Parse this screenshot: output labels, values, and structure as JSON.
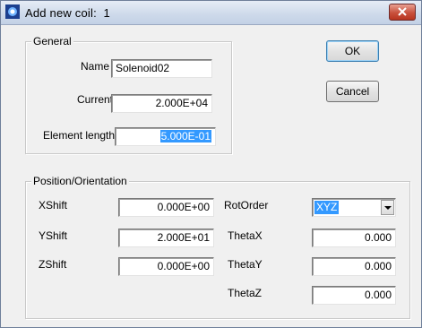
{
  "window": {
    "title": "Add new coil:  1",
    "close_icon": "close-icon",
    "app_icon": "app-icon"
  },
  "general": {
    "group_label": "General",
    "name_label": "Name",
    "name_value": "Solenoid02",
    "current_label": "Current",
    "current_value": "2.000E+04",
    "element_length_label": "Element length",
    "element_length_value": "5.000E-01"
  },
  "buttons": {
    "ok_label": "OK",
    "cancel_label": "Cancel"
  },
  "position": {
    "group_label": "Position/Orientation",
    "xshift_label": "XShift",
    "xshift_value": "0.000E+00",
    "yshift_label": "YShift",
    "yshift_value": "2.000E+01",
    "zshift_label": "ZShift",
    "zshift_value": "0.000E+00",
    "rotorder_label": "RotOrder",
    "rotorder_value": "XYZ",
    "thetax_label": "ThetaX",
    "thetax_value": "0.000",
    "thetay_label": "ThetaY",
    "thetay_value": "0.000",
    "thetaz_label": "ThetaZ",
    "thetaz_value": "0.000"
  },
  "colors": {
    "selection": "#3399ff",
    "close_button": "#c8513d"
  }
}
